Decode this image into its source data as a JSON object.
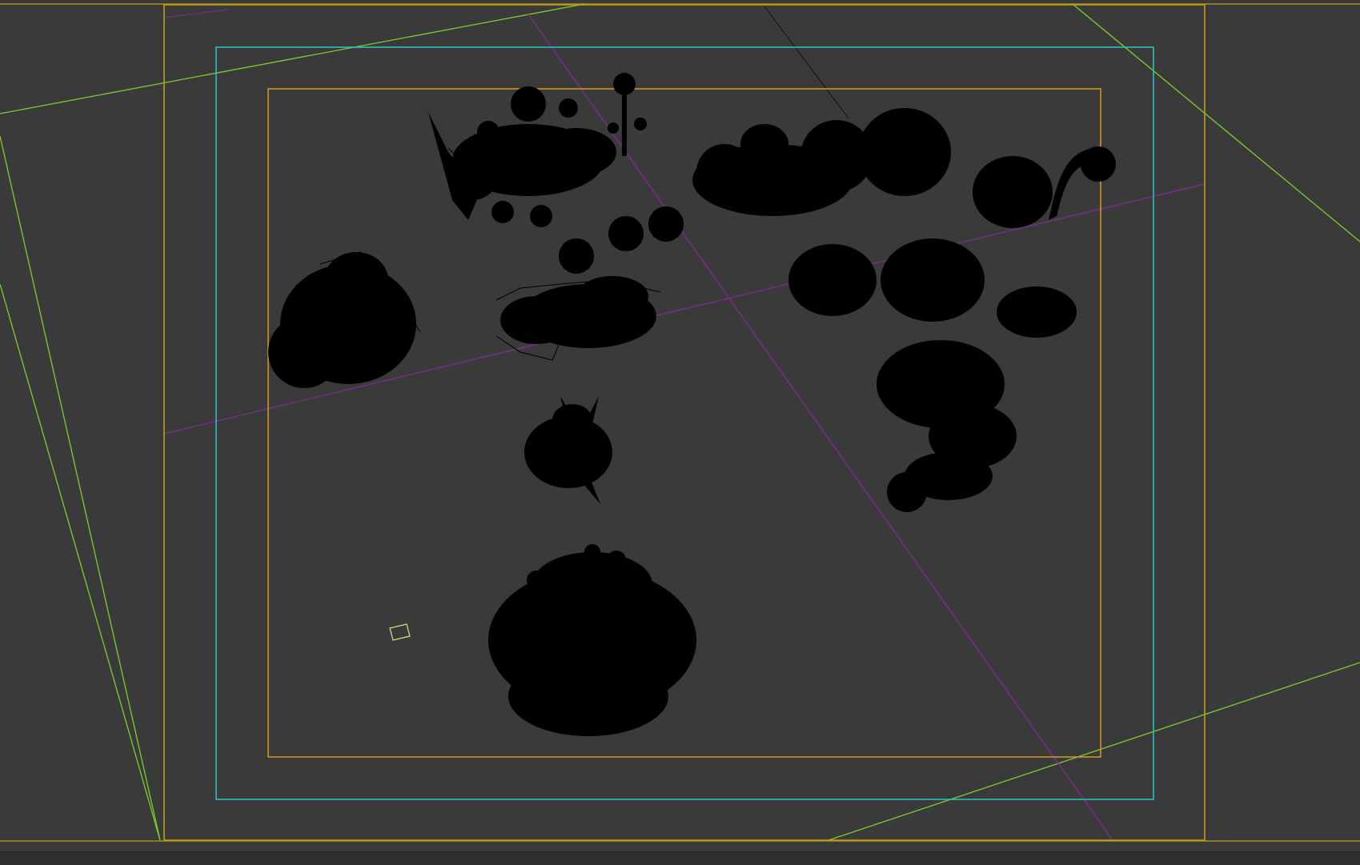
{
  "app": {
    "view": "camera-viewport"
  },
  "colors": {
    "background": "#3a3a3a",
    "frame_outer": "#c8a418",
    "frame_action": "#2ec4c4",
    "frame_title": "#d79b23",
    "guide_green": "#7bcf2a",
    "guide_purple": "#7a2c8c",
    "leaf": "#000000"
  },
  "icons": {
    "viewport_marker": "square-marker-icon"
  }
}
